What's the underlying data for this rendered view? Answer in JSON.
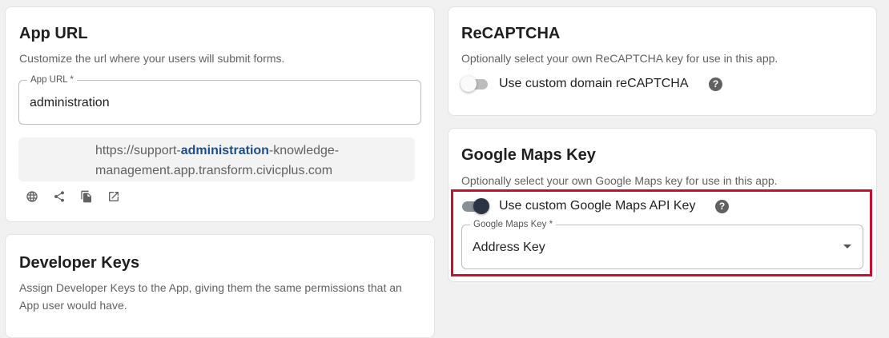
{
  "app_url": {
    "title": "App URL",
    "description": "Customize the url where your users will submit forms.",
    "field_label": "App URL *",
    "field_value": "administration",
    "url_prefix": "https://support-",
    "url_highlight": "administration",
    "url_suffix": "-knowledge-management.app.transform.civicplus.com",
    "actions": [
      {
        "icon": "globe-icon"
      },
      {
        "icon": "share-icon"
      },
      {
        "icon": "copy-icon"
      },
      {
        "icon": "open-in-new-icon"
      }
    ]
  },
  "developer_keys": {
    "title": "Developer Keys",
    "description": "Assign Developer Keys to the App, giving them the same permissions that an App user would have."
  },
  "recaptcha": {
    "title": "ReCAPTCHA",
    "description": "Optionally select your own ReCAPTCHA key for use in this app.",
    "toggle_label": "Use custom domain reCAPTCHA",
    "toggle_on": false,
    "help_glyph": "?"
  },
  "google_maps": {
    "title": "Google Maps Key",
    "description": "Optionally select your own Google Maps key for use in this app.",
    "toggle_label": "Use custom Google Maps API Key",
    "toggle_on": true,
    "help_glyph": "?",
    "select_label": "Google Maps Key *",
    "select_value": "Address Key"
  },
  "colors": {
    "accent_highlight": "#c8102e",
    "url_highlight": "#1d4e89",
    "toggle_on_knob": "#2c3344"
  }
}
